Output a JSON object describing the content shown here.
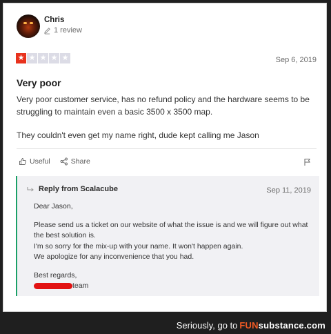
{
  "reviewer": {
    "name": "Chris",
    "review_count": "1 review"
  },
  "review": {
    "rating": 1,
    "rating_max": 5,
    "date": "Sep 6, 2019",
    "title": "Very poor",
    "paragraphs": [
      "Very poor customer service, has no refund policy and the hardware seems to be struggling to maintain even a basic 3500 x 3500 map.",
      "They couldn't even get my name right, dude kept calling me Jason"
    ],
    "actions": {
      "useful_label": "Useful",
      "share_label": "Share"
    }
  },
  "reply": {
    "heading": "Reply from Scalacube",
    "date": "Sep 11, 2019",
    "greeting": "Dear Jason,",
    "lines": [
      "Please send us a ticket on our website of what the issue is and we will figure out what the best solution is.",
      "I'm so sorry for the mix-up with your name. It won't happen again.",
      "We apologize for any inconvenience that you had."
    ],
    "signoff": "Best regards,",
    "signature_suffix": "team"
  },
  "footer": {
    "prefix": "Seriously, go to",
    "brand_fun": "FUN",
    "brand_rest": "substance",
    "brand_tld": ".com"
  },
  "colors": {
    "star_filled": "#e8321d",
    "star_empty": "#dcdce6",
    "reply_accent": "#1aa067",
    "redaction": "#e21212",
    "brand_orange": "#f05a24"
  },
  "icons": [
    "pencil-icon",
    "star-icon",
    "thumbs-up-icon",
    "share-icon",
    "flag-icon",
    "reply-arrow-icon"
  ]
}
